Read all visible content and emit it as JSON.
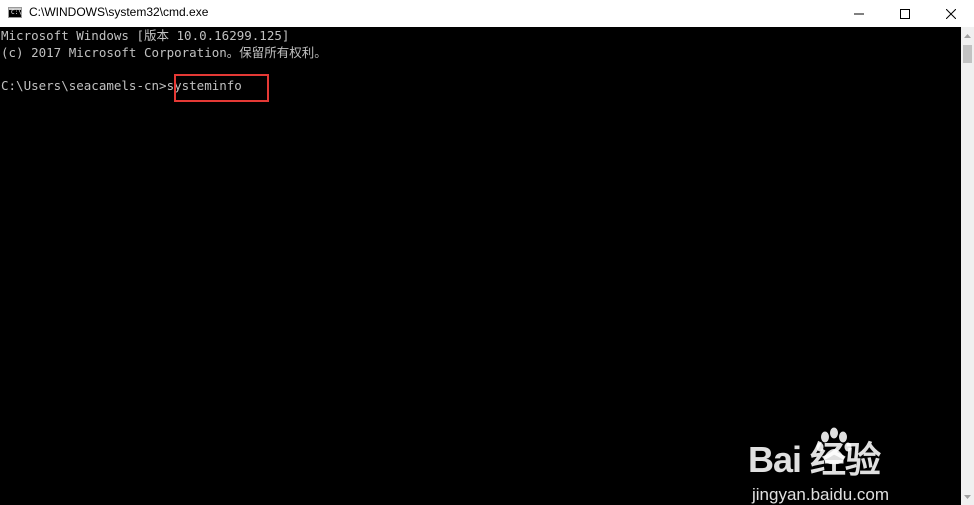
{
  "window": {
    "title": "C:\\WINDOWS\\system32\\cmd.exe",
    "app_icon": "cmd-icon",
    "controls": [
      "minimize-icon",
      "maximize-icon",
      "close-icon"
    ]
  },
  "console": {
    "lines": [
      "Microsoft Windows [版本 10.0.16299.125]",
      "(c) 2017 Microsoft Corporation。保留所有权利。",
      "C:\\Users\\seacamels-cn>systeminfo"
    ],
    "highlighted_command": "systeminfo",
    "background_color": "#000000",
    "text_color": "#c0c0c0",
    "highlight_color": "#e53935"
  },
  "watermark": {
    "brand": "Bai 经验",
    "url": "jingyan.baidu.com"
  }
}
